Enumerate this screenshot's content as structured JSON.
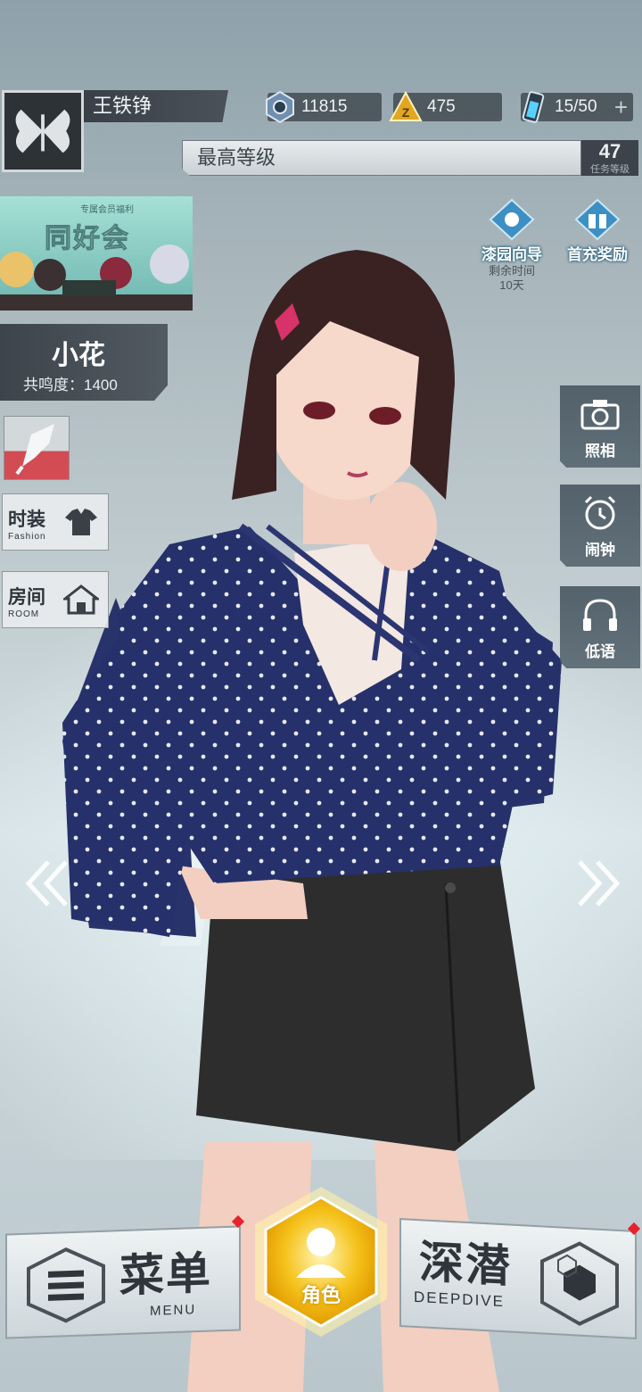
{
  "player": {
    "name": "王铁铮",
    "avatar_icon": "butterfly-icon"
  },
  "currencies": [
    {
      "icon": "crystal-icon",
      "value": "11815"
    },
    {
      "icon": "gem-triangle-icon",
      "value": "475"
    },
    {
      "icon": "stamina-battery-icon",
      "value": "15/50",
      "action": "+"
    }
  ],
  "level": {
    "label": "最高等级",
    "number": "47",
    "caption": "任务等级"
  },
  "banner": {
    "subtitle": "专属会员福利",
    "title": "同好会"
  },
  "top_nav": [
    {
      "label": "漆园向导",
      "icon": "guide-icon",
      "note_line1": "剩余时间",
      "note_line2": "10天"
    },
    {
      "label": "首充奖励",
      "icon": "gift-icon"
    }
  ],
  "character": {
    "name": "小花",
    "resonance": "共鸣度：1400"
  },
  "left_menu": [
    {
      "zh": "时装",
      "en": "Fashion",
      "icon": "shirt-icon"
    },
    {
      "zh": "房间",
      "en": "ROOM",
      "icon": "house-icon"
    }
  ],
  "right_menu": [
    {
      "label": "照相",
      "icon": "camera-icon"
    },
    {
      "label": "闹钟",
      "icon": "alarm-clock-icon"
    },
    {
      "label": "低语",
      "icon": "headphones-icon"
    }
  ],
  "bottom": {
    "menu": {
      "zh": "菜单",
      "en": "MENU"
    },
    "role": {
      "label": "角色"
    },
    "deepdive": {
      "zh": "深潜",
      "en": "DEEPDIVE"
    }
  },
  "colors": {
    "accent_gold": "#f5c21b",
    "alert_red": "#e4242c",
    "dark_panel": "#3d444b"
  }
}
